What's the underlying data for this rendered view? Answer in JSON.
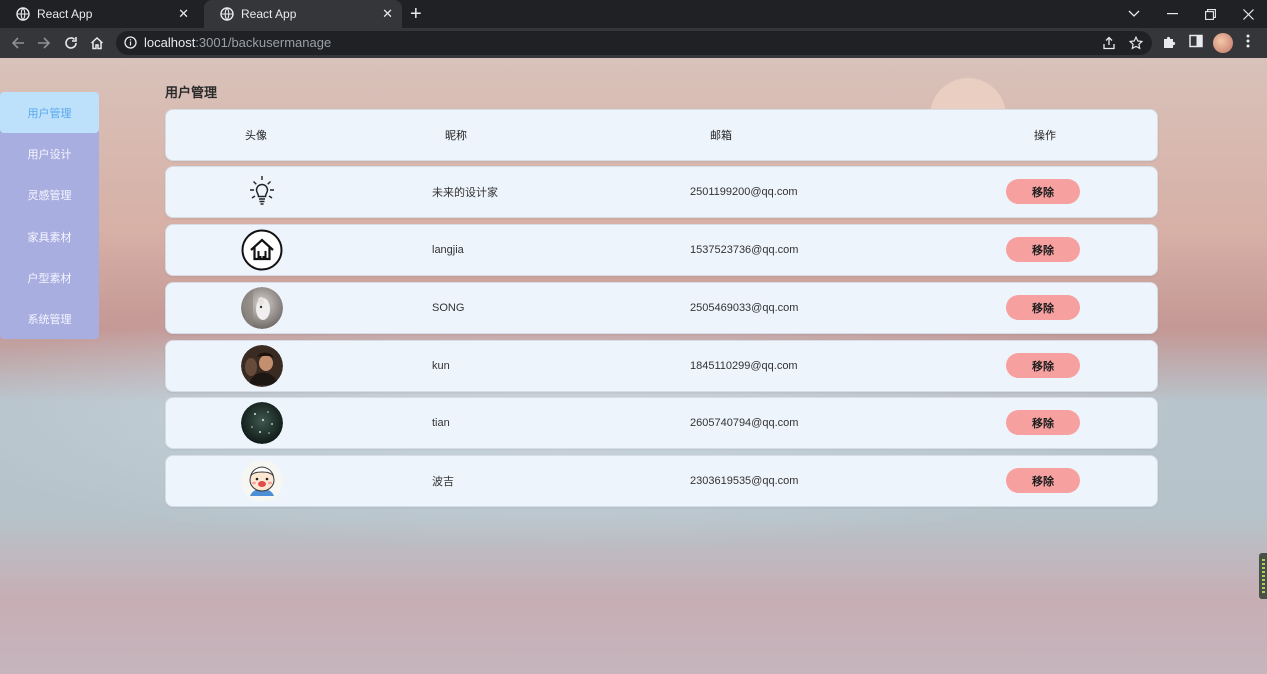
{
  "browser": {
    "tabs": [
      {
        "title": "React App",
        "active": false
      },
      {
        "title": "React App",
        "active": true
      }
    ],
    "url_host": "localhost",
    "url_path": ":3001/backusermanage",
    "icons": {
      "back": "arrow-left-icon",
      "forward": "arrow-right-icon",
      "reload": "reload-icon",
      "home": "home-icon",
      "info": "info-icon",
      "share": "share-icon",
      "bookmark": "star-icon",
      "extensions": "puzzle-icon",
      "sidepanel": "sidepanel-icon",
      "menu": "kebab-menu-icon"
    }
  },
  "sidebar": {
    "items": [
      {
        "label": "用户管理",
        "active": true
      },
      {
        "label": "用户设计",
        "active": false
      },
      {
        "label": "灵感管理",
        "active": false
      },
      {
        "label": "家具素材",
        "active": false
      },
      {
        "label": "户型素材",
        "active": false
      },
      {
        "label": "系统管理",
        "active": false
      }
    ]
  },
  "page": {
    "title": "用户管理"
  },
  "table": {
    "headers": {
      "avatar": "头像",
      "nickname": "昵称",
      "email": "邮箱",
      "action": "操作"
    },
    "rows": [
      {
        "avatar": "lightbulb-avatar",
        "nickname": "未来的设计家",
        "email": "2501199200@qq.com",
        "action": "移除"
      },
      {
        "avatar": "house-logo-avatar",
        "nickname": "langjia",
        "email": "1537523736@qq.com",
        "action": "移除"
      },
      {
        "avatar": "dog-photo-avatar",
        "nickname": "SONG",
        "email": "2505469033@qq.com",
        "action": "移除"
      },
      {
        "avatar": "person-photo-avatar",
        "nickname": "kun",
        "email": "1845110299@qq.com",
        "action": "移除"
      },
      {
        "avatar": "night-photo-avatar",
        "nickname": "tian",
        "email": "2605740794@qq.com",
        "action": "移除"
      },
      {
        "avatar": "cartoon-avatar",
        "nickname": "波吉",
        "email": "2303619535@qq.com",
        "action": "移除"
      }
    ]
  },
  "colors": {
    "sidebar_bg": "#a9aee0",
    "sidebar_active_bg": "#bde0fb",
    "sidebar_active_text": "#5aa8ee",
    "row_bg": "#eef4fc",
    "remove_button": "#f7a0a0"
  }
}
